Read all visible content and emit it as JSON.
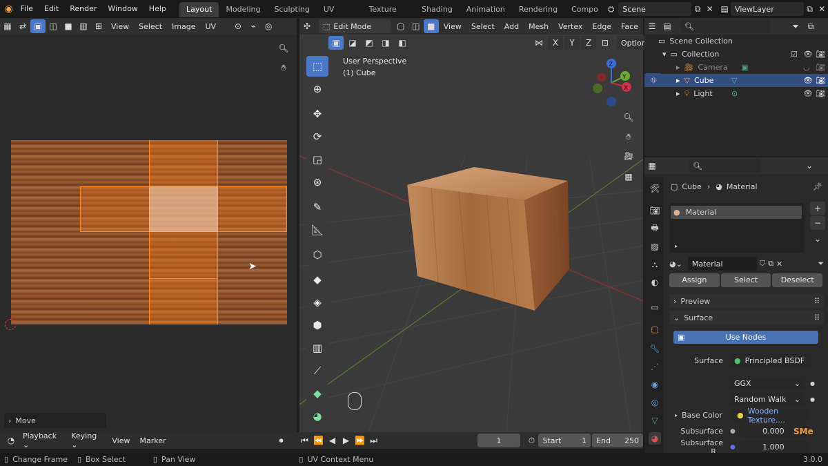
{
  "top_menu": [
    "File",
    "Edit",
    "Render",
    "Window",
    "Help"
  ],
  "workspaces": [
    "Layout",
    "Modeling",
    "Sculpting",
    "UV Editing",
    "Texture Paint",
    "Shading",
    "Animation",
    "Rendering",
    "Compo"
  ],
  "active_workspace": "Layout",
  "scene_name": "Scene",
  "view_layer": "ViewLayer",
  "uv_editor": {
    "menus": [
      "View",
      "Select",
      "Image",
      "UV"
    ],
    "operator_panel": "Move"
  },
  "viewport": {
    "mode": "Edit Mode",
    "menus": [
      "View",
      "Select",
      "Add",
      "Mesh",
      "Vertex",
      "Edge",
      "Face"
    ],
    "axes": [
      "X",
      "Y",
      "Z"
    ],
    "options_label": "Options",
    "overlay_line1": "User Perspective",
    "overlay_line2": "(1) Cube",
    "gizmo_labels": [
      "Z",
      "Y",
      "X"
    ]
  },
  "outliner": {
    "root": "Scene Collection",
    "collection": "Collection",
    "items": [
      "Camera",
      "Cube",
      "Light"
    ],
    "selected": "Cube"
  },
  "properties": {
    "breadcrumb_object": "Cube",
    "breadcrumb_section": "Material",
    "slot_name": "Material",
    "material_name": "Material",
    "buttons": [
      "Assign",
      "Select",
      "Deselect"
    ],
    "preview_label": "Preview",
    "surface_panel": "Surface",
    "use_nodes": "Use Nodes",
    "surface_label": "Surface",
    "surface_value": "Principled BSDF",
    "distribution": "GGX",
    "subsurface_method": "Random Walk",
    "base_color_label": "Base Color",
    "base_color_value": "Wooden Texture....",
    "subsurface_label": "Subsurface",
    "subsurface_value": "0.000",
    "subsurface_r_label": "Subsurface R...",
    "subsurface_r_value": "1.000",
    "accent_color": "#4772b3",
    "logo_text": "SMe"
  },
  "timeline": {
    "menus": [
      "Playback",
      "Keying",
      "View",
      "Marker"
    ],
    "current_frame": "1",
    "start_label": "Start",
    "start_value": "1",
    "end_label": "End",
    "end_value": "250"
  },
  "statusbar": {
    "items": [
      "Change Frame",
      "Box Select",
      "Pan View",
      "UV Context Menu"
    ],
    "version": "3.0.0"
  }
}
